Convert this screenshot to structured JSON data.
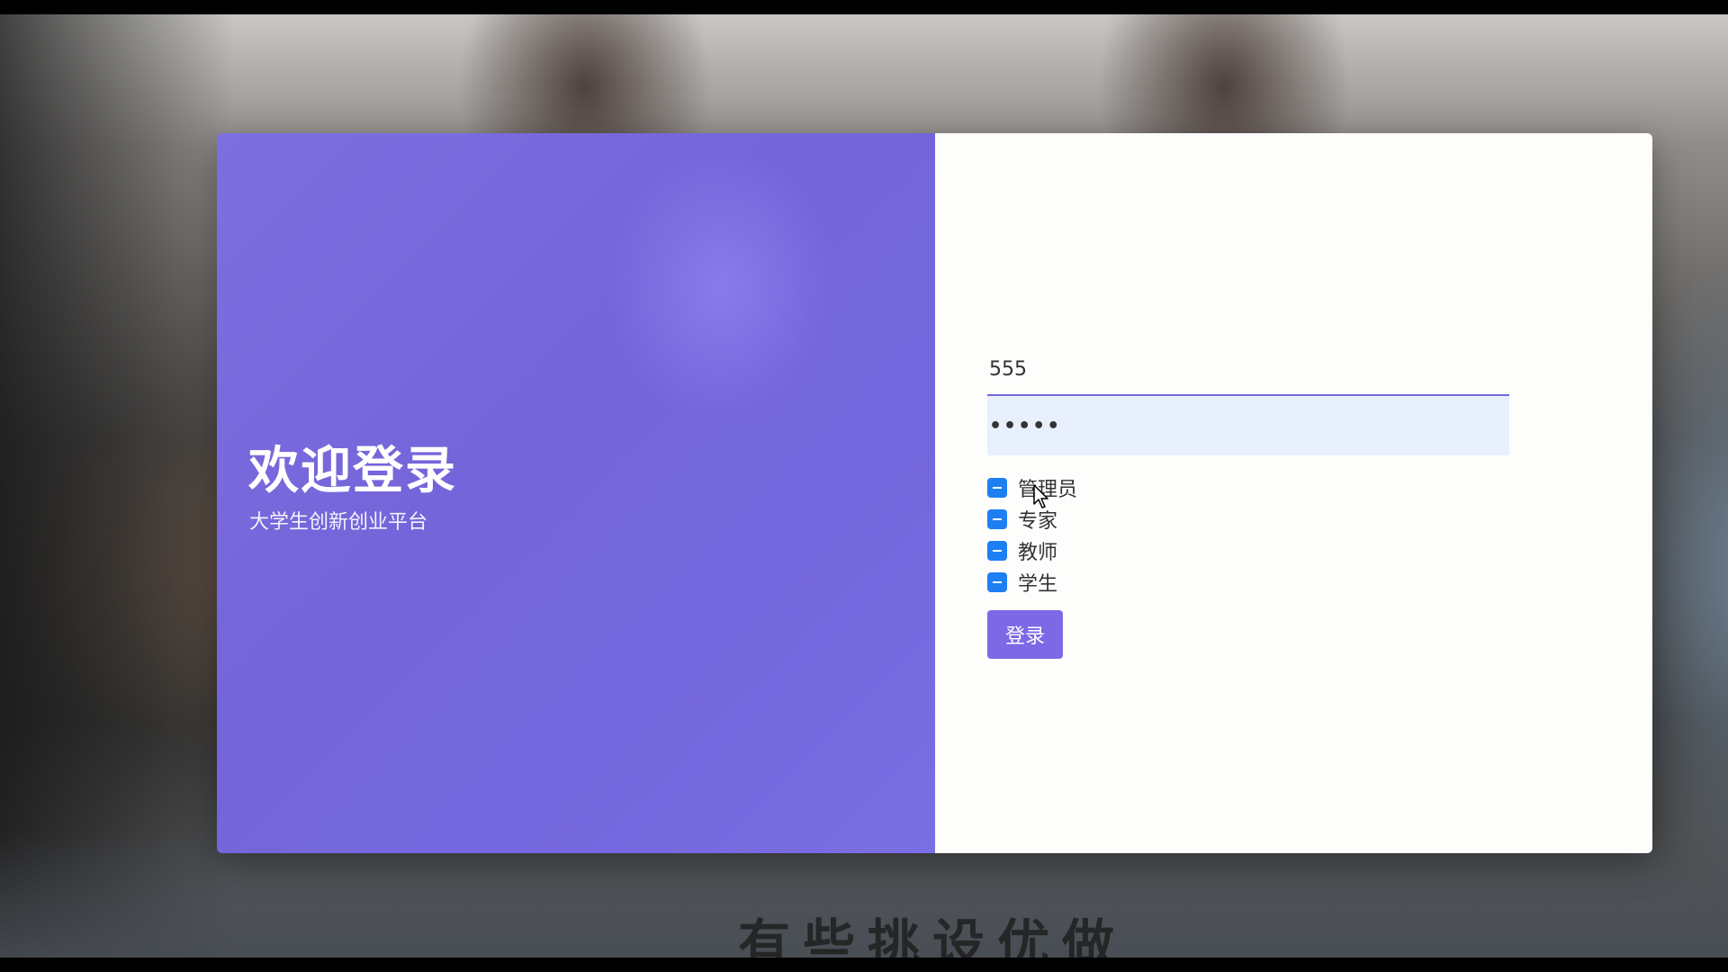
{
  "left_panel": {
    "title": "欢迎登录",
    "subtitle": "大学生创新创业平台"
  },
  "form": {
    "username_value": "555",
    "password_value": "•••••",
    "roles": [
      {
        "label": "管理员",
        "checked": true
      },
      {
        "label": "专家",
        "checked": true
      },
      {
        "label": "教师",
        "checked": true
      },
      {
        "label": "学生",
        "checked": true
      }
    ],
    "login_label": "登录"
  },
  "overlay": {
    "caption_fragment": "有些挑设优做"
  },
  "colors": {
    "left_panel": "#7466dc",
    "checkbox": "#1e7ff2",
    "button": "#7d68e6",
    "password_field_bg": "#e8effd"
  }
}
